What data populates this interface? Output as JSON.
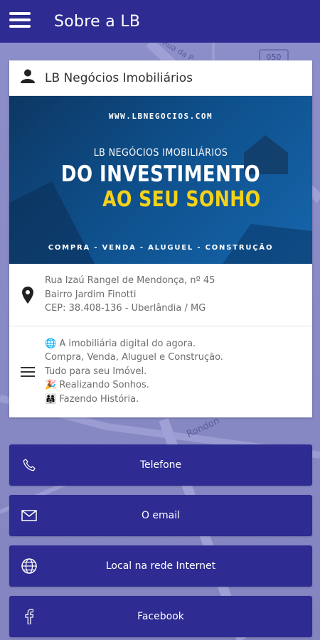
{
  "app_bar": {
    "title": "Sobre a LB",
    "menu_icon": "hamburger-menu-icon",
    "background": "#2e2b92"
  },
  "map": {
    "street_labels": [
      "Rua da P",
      "050",
      "Rondon"
    ]
  },
  "card": {
    "title": "LB Negócios Imobiliários",
    "title_icon": "person-icon",
    "banner": {
      "url": "WWW.LBNEGOCIOS.COM",
      "line1": "LB NEGÓCIOS IMOBILIÁRIOS",
      "line2": "DO INVESTIMENTO",
      "line3": "AO SEU SONHO",
      "footer": "COMPRA - VENDA - ALUGUEL - CONSTRUÇÃO",
      "accent": "#f5d21a"
    },
    "address": {
      "icon": "location-pin-icon",
      "lines": [
        "Rua Izaú Rangel de Mendonça, nº 45",
        "Bairro Jardim Finotti",
        "CEP: 38.408-136 - Uberlândia / MG"
      ]
    },
    "description": {
      "icon": "text-lines-icon",
      "lines": [
        "🌐 A imobiliária digital do agora.",
        "Compra, Venda, Aluguel e Construção.",
        "Tudo para seu Imóvel.",
        "🎉 Realizando Sonhos.",
        "👨‍👩‍👧 Fazendo História."
      ]
    }
  },
  "buttons": [
    {
      "label": "Telefone",
      "icon": "phone-icon"
    },
    {
      "label": "O email",
      "icon": "envelope-icon"
    },
    {
      "label": "Local na rede Internet",
      "icon": "globe-icon"
    },
    {
      "label": "Facebook",
      "icon": "facebook-icon"
    }
  ]
}
